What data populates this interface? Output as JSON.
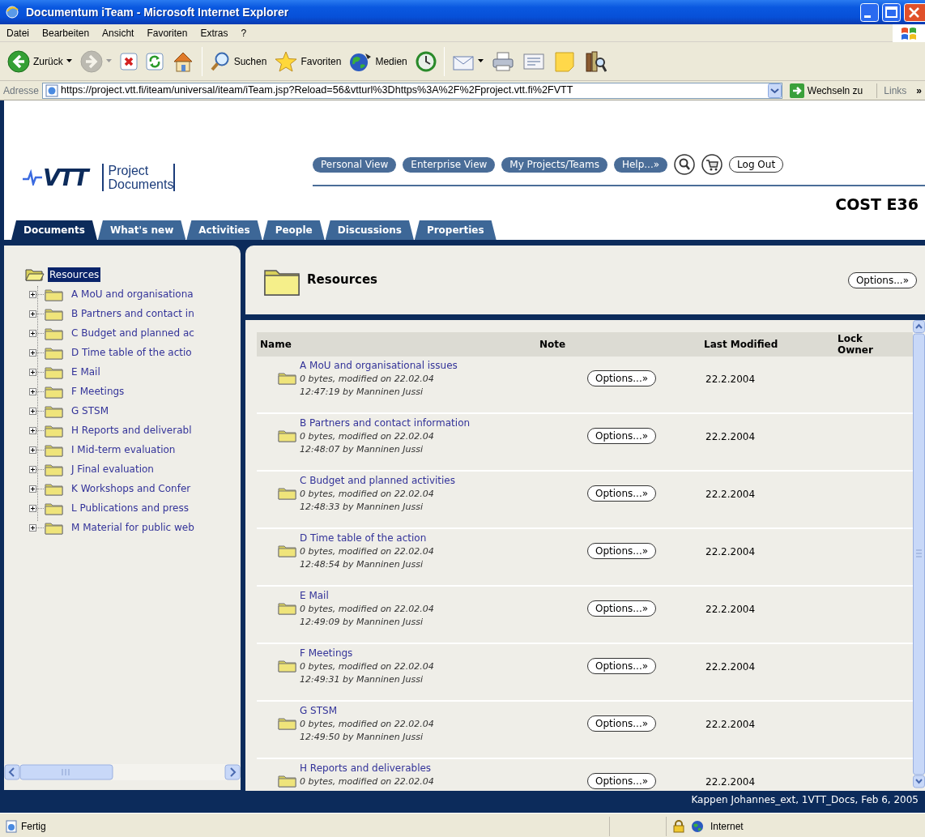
{
  "window": {
    "title": "Documentum iTeam - Microsoft Internet Explorer"
  },
  "menu_bar": [
    "Datei",
    "Bearbeiten",
    "Ansicht",
    "Favoriten",
    "Extras",
    "?"
  ],
  "toolbar": [
    {
      "kind": "back",
      "label": "Zurück",
      "dropdown": true,
      "disabled": false
    },
    {
      "kind": "forward",
      "dropdown": true,
      "disabled": true
    },
    {
      "kind": "stop",
      "dropdown": false,
      "disabled": false
    },
    {
      "kind": "refresh",
      "dropdown": false,
      "disabled": false
    },
    {
      "kind": "home",
      "dropdown": false,
      "disabled": false
    },
    {
      "kind": "separator"
    },
    {
      "kind": "search",
      "label": "Suchen",
      "dropdown": false,
      "disabled": false
    },
    {
      "kind": "favorites",
      "label": "Favoriten",
      "dropdown": false,
      "disabled": false
    },
    {
      "kind": "media",
      "label": "Medien",
      "dropdown": false,
      "disabled": false
    },
    {
      "kind": "history",
      "dropdown": false,
      "disabled": false
    },
    {
      "kind": "separator"
    },
    {
      "kind": "mail",
      "dropdown": true,
      "disabled": false
    },
    {
      "kind": "print",
      "dropdown": false,
      "disabled": false
    },
    {
      "kind": "edit",
      "dropdown": false,
      "disabled": false
    },
    {
      "kind": "notes",
      "dropdown": false,
      "disabled": false
    },
    {
      "kind": "research",
      "dropdown": false,
      "disabled": false
    }
  ],
  "address_bar": {
    "label": "Adresse",
    "url": "https://project.vtt.fi/iteam/universal/iteam/iTeam.jsp?Reload=56&vtturl%3Dhttps%3A%2F%2Fproject.vtt.fi%2FVTT",
    "go_label": "Wechseln zu",
    "links_label": "Links",
    "more": "»"
  },
  "header": {
    "logo": "VTT",
    "product": "Project Documents",
    "nav_buttons": [
      "Personal View",
      "Enterprise View",
      "My Projects/Teams",
      "Help...»"
    ],
    "logout": "Log Out",
    "project": "COST E36"
  },
  "tabs": [
    {
      "label": "Documents",
      "selected": true
    },
    {
      "label": "What's new",
      "selected": false
    },
    {
      "label": "Activities",
      "selected": false
    },
    {
      "label": "People",
      "selected": false
    },
    {
      "label": "Discussions",
      "selected": false
    },
    {
      "label": "Properties",
      "selected": false
    }
  ],
  "tree": {
    "label": "Resources",
    "selected": true,
    "expanded": true,
    "children": [
      {
        "label": "A MoU and organisationa",
        "selected": false,
        "expanded": false
      },
      {
        "label": "B Partners and contact in",
        "selected": false,
        "expanded": false
      },
      {
        "label": "C Budget and planned ac",
        "selected": false,
        "expanded": false
      },
      {
        "label": "D Time table of the actio",
        "selected": false,
        "expanded": false
      },
      {
        "label": "E Mail",
        "selected": false,
        "expanded": false
      },
      {
        "label": "F Meetings",
        "selected": false,
        "expanded": false
      },
      {
        "label": "G STSM",
        "selected": false,
        "expanded": false
      },
      {
        "label": "H Reports and deliverabl",
        "selected": false,
        "expanded": false
      },
      {
        "label": "I Mid-term evaluation",
        "selected": false,
        "expanded": false
      },
      {
        "label": "J Final evaluation",
        "selected": false,
        "expanded": false
      },
      {
        "label": "K Workshops and Confer",
        "selected": false,
        "expanded": false
      },
      {
        "label": "L Publications and press",
        "selected": false,
        "expanded": false
      },
      {
        "label": "M Material for public web",
        "selected": false,
        "expanded": false
      }
    ]
  },
  "folder_panel": {
    "title": "Resources",
    "options": "Options...»"
  },
  "table": {
    "columns": [
      "Name",
      "Note",
      "Last Modified",
      "Lock Owner"
    ],
    "rows": [
      {
        "name": "A MoU and organisational issues",
        "details": [
          "0 bytes, modified on 22.02.04",
          "12:47:19 by Manninen Jussi"
        ],
        "options": "Options...»",
        "last_modified": "22.2.2004"
      },
      {
        "name": "B Partners and contact information",
        "details": [
          "0 bytes, modified on 22.02.04",
          "12:48:07 by Manninen Jussi"
        ],
        "options": "Options...»",
        "last_modified": "22.2.2004"
      },
      {
        "name": "C Budget and planned activities",
        "details": [
          "0 bytes, modified on 22.02.04",
          "12:48:33 by Manninen Jussi"
        ],
        "options": "Options...»",
        "last_modified": "22.2.2004"
      },
      {
        "name": "D Time table of the action",
        "details": [
          "0 bytes, modified on 22.02.04",
          "12:48:54 by Manninen Jussi"
        ],
        "options": "Options...»",
        "last_modified": "22.2.2004"
      },
      {
        "name": "E Mail",
        "details": [
          "0 bytes, modified on 22.02.04",
          "12:49:09 by Manninen Jussi"
        ],
        "options": "Options...»",
        "last_modified": "22.2.2004"
      },
      {
        "name": "F Meetings",
        "details": [
          "0 bytes, modified on 22.02.04",
          "12:49:31 by Manninen Jussi"
        ],
        "options": "Options...»",
        "last_modified": "22.2.2004"
      },
      {
        "name": "G STSM",
        "details": [
          "0 bytes, modified on 22.02.04",
          "12:49:50 by Manninen Jussi"
        ],
        "options": "Options...»",
        "last_modified": "22.2.2004"
      },
      {
        "name": "H Reports and deliverables",
        "details": [
          "0 bytes, modified on 22.02.04"
        ],
        "options": "Options...»",
        "last_modified": "22.2.2004"
      }
    ]
  },
  "footer": "Kappen Johannes_ext, 1VTT_Docs, Feb 6, 2005",
  "status_bar": {
    "text": "Fertig",
    "zone": "Internet"
  }
}
